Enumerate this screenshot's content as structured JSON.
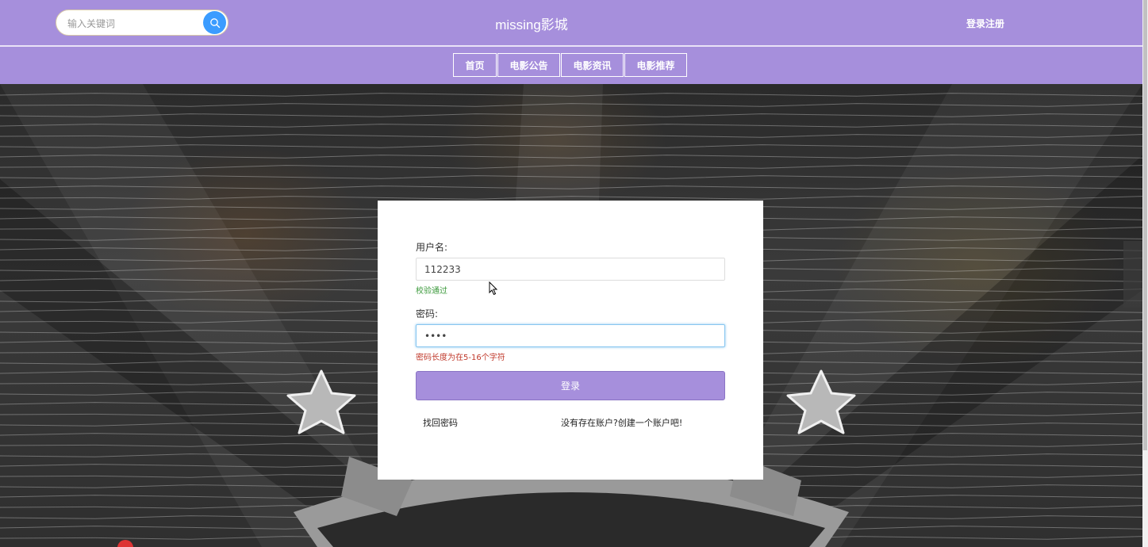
{
  "header": {
    "search_placeholder": "输入关键词",
    "site_title": "missing影城",
    "login_register": "登录注册"
  },
  "nav": {
    "items": [
      {
        "label": "首页"
      },
      {
        "label": "电影公告"
      },
      {
        "label": "电影资讯"
      },
      {
        "label": "电影推荐"
      }
    ]
  },
  "login_form": {
    "username_label": "用户名:",
    "username_value": "112233",
    "username_hint": "校验通过",
    "password_label": "密码:",
    "password_value": "••••",
    "password_hint": "密码长度为在5-16个字符",
    "submit_label": "登录",
    "forgot_link": "找回密码",
    "register_link": "没有存在账户?创建一个账户吧!"
  },
  "colors": {
    "brand": "#a68fdc",
    "search_button": "#3b9cff",
    "hint_ok": "#3c9a3c",
    "hint_error": "#c0392b"
  }
}
